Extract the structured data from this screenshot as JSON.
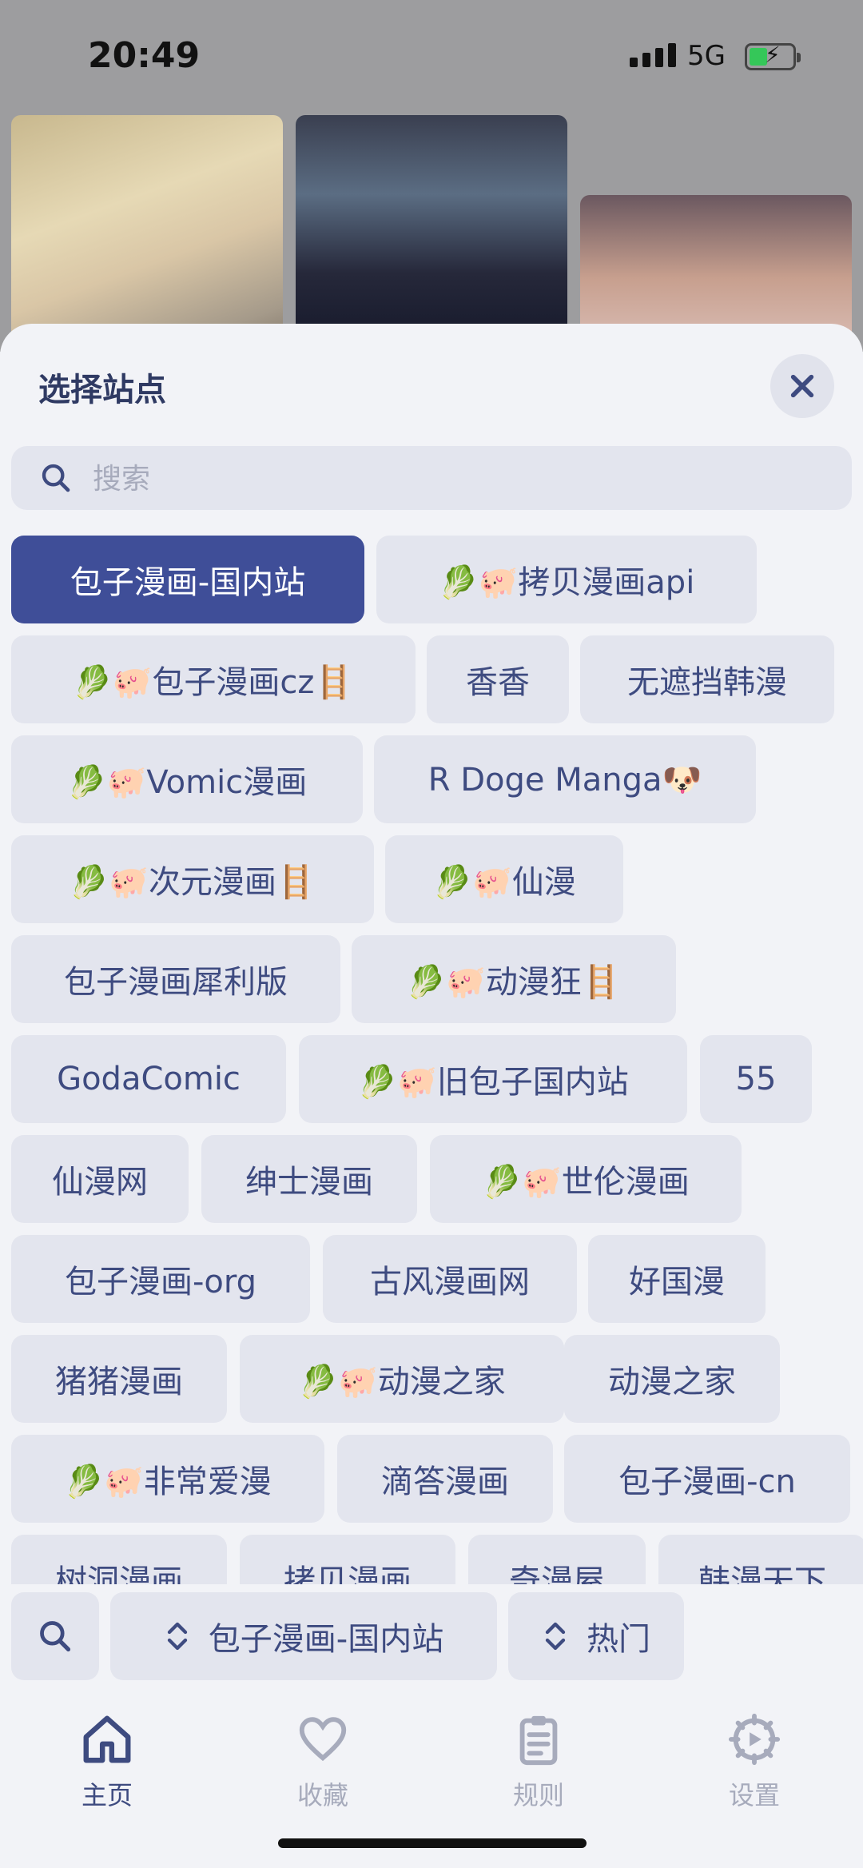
{
  "status_bar": {
    "time": "20:49",
    "network": "5G"
  },
  "sheet": {
    "title": "选择站点",
    "search_placeholder": "搜索"
  },
  "sites": [
    [
      "包子漫画-国内站",
      "🥬🐖拷贝漫画api"
    ],
    [
      "🥬🐖包子漫画cz🪜",
      "香香",
      "无遮挡韩漫"
    ],
    [
      "🥬🐖Vomic漫画",
      "R Doge Manga🐶"
    ],
    [
      "🥬🐖次元漫画🪜",
      "🥬🐖仙漫"
    ],
    [
      "包子漫画犀利版",
      "🥬🐖动漫狂🪜"
    ],
    [
      "GodaComic",
      "🥬🐖旧包子国内站",
      "55"
    ],
    [
      "仙漫网",
      "绅士漫画",
      "🥬🐖世伦漫画"
    ],
    [
      "包子漫画-org",
      "古风漫画网",
      "好国漫"
    ],
    [
      "猪猪漫画",
      "🥬🐖动漫之家",
      "动漫之家"
    ],
    [
      "🥬🐖非常爱漫",
      "滴答漫画",
      "包子漫画-cn"
    ],
    [
      "树洞漫画",
      "拷贝漫画",
      "奇漫屋",
      "韩漫天下"
    ]
  ],
  "selected_site": "包子漫画-国内站",
  "toolbar": {
    "site_selector": "包子漫画-国内站",
    "sort_selector": "热门"
  },
  "tabs": [
    {
      "label": "主页",
      "icon": "home-icon"
    },
    {
      "label": "收藏",
      "icon": "heart-icon"
    },
    {
      "label": "规则",
      "icon": "clipboard-icon"
    },
    {
      "label": "设置",
      "icon": "settings-icon"
    }
  ]
}
